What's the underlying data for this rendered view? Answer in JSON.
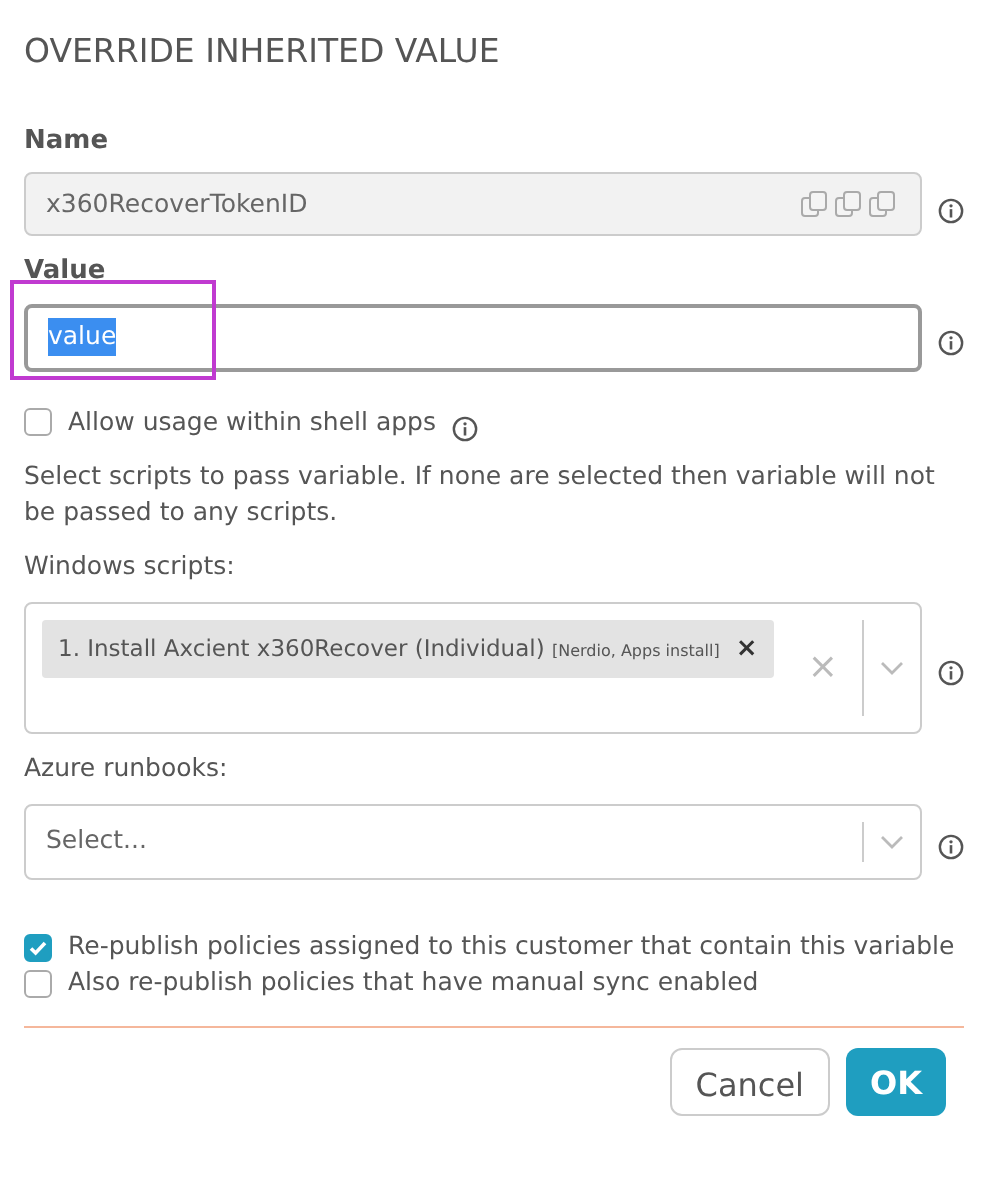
{
  "title": "OVERRIDE INHERITED VALUE",
  "name_field": {
    "label": "Name",
    "value": "x360RecoverTokenID",
    "disabled": true
  },
  "value_field": {
    "label": "Value",
    "value": "value",
    "highlighted": true
  },
  "shell_apps": {
    "label": "Allow usage within shell apps",
    "checked": false
  },
  "scripts_note": "Select scripts to pass variable. If none are selected then variable will not be passed to any scripts.",
  "windows_scripts": {
    "label": "Windows scripts:",
    "tags": [
      {
        "text": "1. Install Axcient x360Recover (Individual)",
        "detail": "[Nerdio, Apps install]",
        "remove": "×"
      }
    ],
    "clear": "×"
  },
  "azure_runbooks": {
    "label": "Azure runbooks:",
    "placeholder": "Select..."
  },
  "options": [
    {
      "label": "Re-publish policies assigned to this customer that contain this variable",
      "checked": true
    },
    {
      "label": "Also re-publish policies that have manual sync enabled",
      "checked": false
    }
  ],
  "buttons": [
    {
      "label": "Cancel",
      "kind": "secondary"
    },
    {
      "label": "OK",
      "kind": "primary"
    }
  ]
}
